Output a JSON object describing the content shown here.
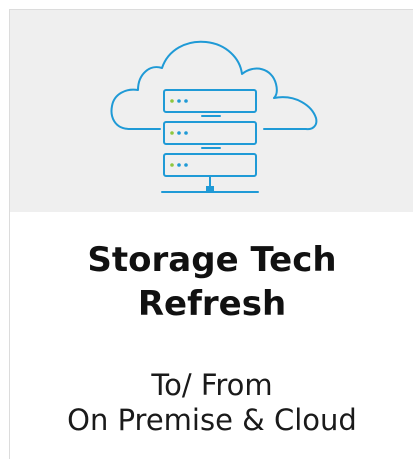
{
  "card": {
    "icon": "cloud-server-icon",
    "colors": {
      "icon_stroke": "#1f9ad6",
      "status_dot_green": "#8dc63f",
      "status_dot_blue": "#1f9ad6",
      "media_background": "#efefef",
      "title_color": "#111111"
    },
    "title_lines": [
      "Storage Tech",
      "Refresh"
    ],
    "subtitle_lines": [
      "To/ From",
      "On Premise & Cloud"
    ]
  }
}
